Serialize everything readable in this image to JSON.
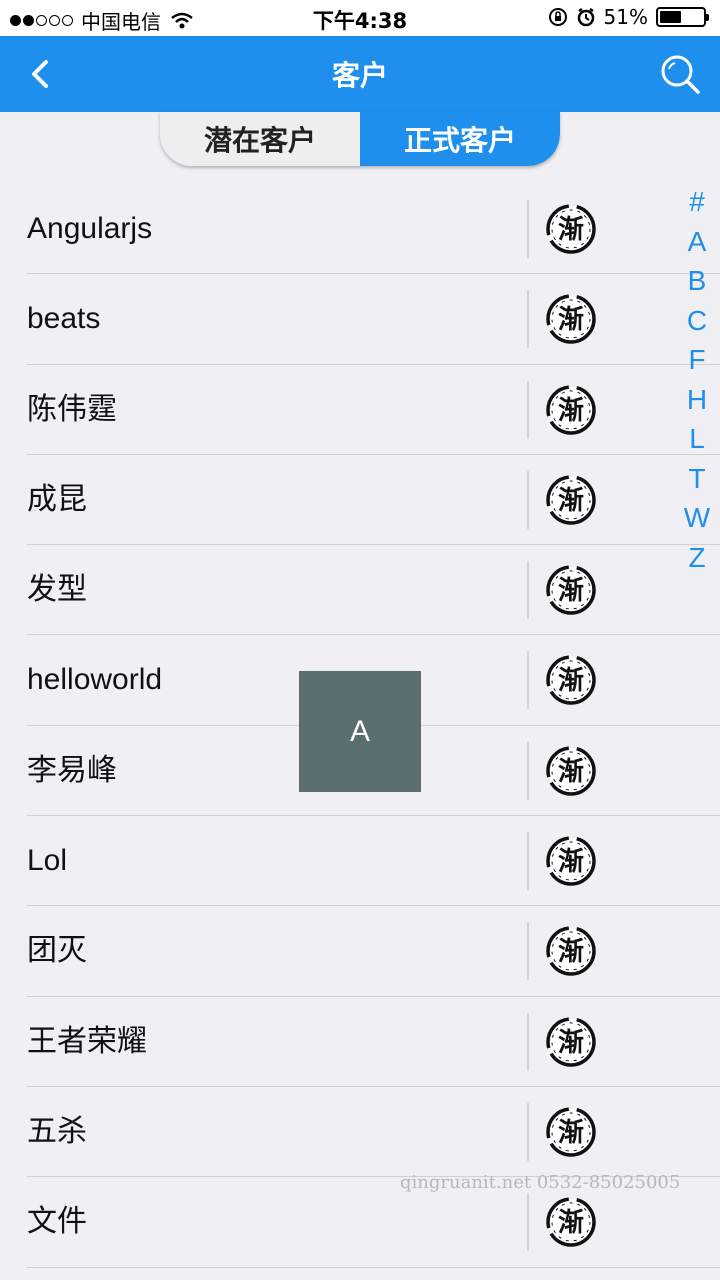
{
  "status_bar": {
    "carrier": "中国电信",
    "time": "下午4:38",
    "battery_percent": "51%",
    "battery_level": 0.51,
    "signal_bars_filled": 2,
    "signal_bars_total": 5
  },
  "nav": {
    "title": "客户",
    "back_icon": "chevron-left-icon",
    "search_icon": "search-icon"
  },
  "segment": {
    "tabs": [
      {
        "label": "潜在客户",
        "active": false
      },
      {
        "label": "正式客户",
        "active": true
      }
    ]
  },
  "customers": [
    {
      "name": "Angularjs"
    },
    {
      "name": "beats"
    },
    {
      "name": "陈伟霆"
    },
    {
      "name": "成昆"
    },
    {
      "name": "发型"
    },
    {
      "name": "helloworld"
    },
    {
      "name": "李易峰"
    },
    {
      "name": "Lol"
    },
    {
      "name": "团灭"
    },
    {
      "name": "王者荣耀"
    },
    {
      "name": "五杀"
    },
    {
      "name": "文件"
    }
  ],
  "logo_text": "渐",
  "index": [
    "#",
    "A",
    "B",
    "C",
    "F",
    "H",
    "L",
    "T",
    "W",
    "Z"
  ],
  "toast": {
    "letter": "A"
  },
  "watermark": "qingruanit.net 0532-85025005",
  "colors": {
    "accent": "#1e8fec",
    "toast_bg": "#5a6e70",
    "background": "#efeff4"
  }
}
